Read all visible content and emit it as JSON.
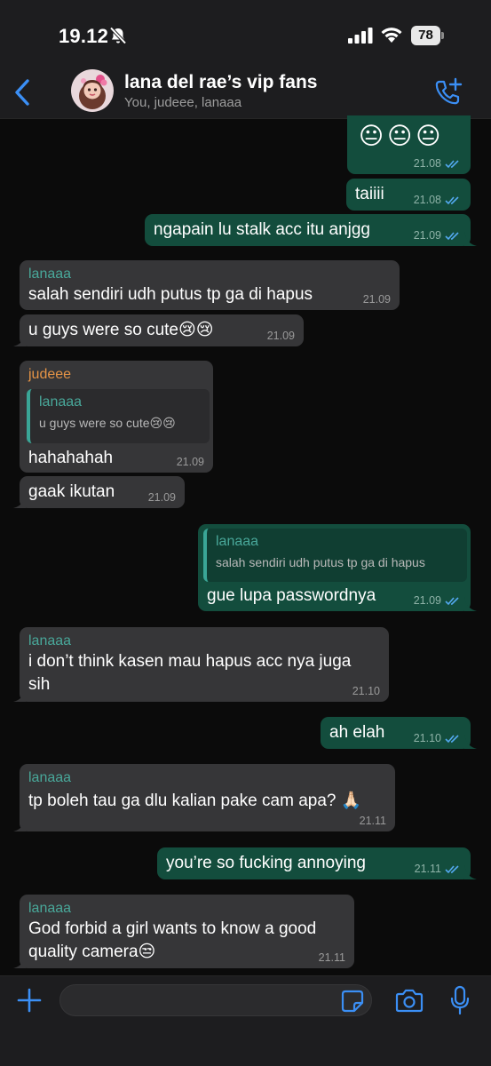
{
  "status": {
    "time": "19.12",
    "battery": "78"
  },
  "header": {
    "title": "lana del rae’s vip fans",
    "subtitle": "You, judeee, lanaaa"
  },
  "messages": [
    {
      "dir": "out",
      "text": "😐😐😐",
      "time": "21.08"
    },
    {
      "dir": "out",
      "text": "taiiii",
      "time": "21.08"
    },
    {
      "dir": "out",
      "text": "ngapain lu stalk acc itu anjgg",
      "time": "21.09"
    },
    {
      "dir": "in",
      "sender": "lanaaa",
      "text": "salah sendiri udh putus tp ga di hapus",
      "time": "21.09"
    },
    {
      "dir": "in",
      "text": "u guys were so cute😢😢",
      "time": "21.09"
    },
    {
      "dir": "in",
      "sender": "judeee",
      "quote": {
        "name": "lanaaa",
        "text": "u guys were so cute😢😢"
      },
      "text": "hahahahah",
      "time": "21.09"
    },
    {
      "dir": "in",
      "text": "gaak ikutan",
      "time": "21.09"
    },
    {
      "dir": "out",
      "quote": {
        "name": "lanaaa",
        "text": "salah sendiri udh putus tp ga di hapus"
      },
      "text": "gue lupa passwordnya",
      "time": "21.09"
    },
    {
      "dir": "in",
      "sender": "lanaaa",
      "text_lines": [
        "i don’t think kasen mau hapus acc nya juga",
        "sih"
      ],
      "time": "21.10"
    },
    {
      "dir": "out",
      "text": "ah elah",
      "time": "21.10"
    },
    {
      "dir": "in",
      "sender": "lanaaa",
      "text": "tp boleh tau ga dlu kalian pake cam apa? 🙏🏻",
      "time": "21.11"
    },
    {
      "dir": "out",
      "text": "you’re so fucking annoying",
      "time": "21.11"
    },
    {
      "dir": "in",
      "sender": "lanaaa",
      "text_lines": [
        "God forbid a girl wants to know a good",
        "quality camera😒"
      ],
      "time": "21.11"
    }
  ],
  "input": {
    "placeholder": ""
  },
  "colors": {
    "outgoing_bubble": "#134d3d",
    "incoming_bubble": "#363638",
    "accent_blue": "#3b8ff5",
    "sender_teal": "#49a89a",
    "sender_orange": "#e59446"
  },
  "icons": [
    "bell-slash-icon",
    "signal-icon",
    "wifi-icon",
    "back-chevron-icon",
    "add-call-icon",
    "plus-icon",
    "sticker-icon",
    "camera-icon",
    "microphone-icon",
    "double-check-icon"
  ]
}
